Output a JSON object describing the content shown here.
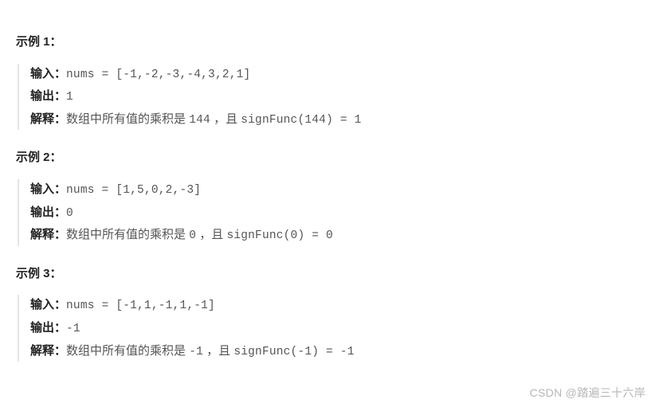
{
  "labels": {
    "input": "输入：",
    "output": "输出：",
    "explain": "解释："
  },
  "examples": [
    {
      "title": "示例 1：",
      "input": "nums = [-1,-2,-3,-4,3,2,1]",
      "output": "1",
      "explain_prefix": "数组中所有值的乘积是 ",
      "product": "144",
      "explain_mid": " ，且 ",
      "sign_expr": "signFunc(144) = 1"
    },
    {
      "title": "示例 2：",
      "input": "nums = [1,5,0,2,-3]",
      "output": "0",
      "explain_prefix": "数组中所有值的乘积是 ",
      "product": "0",
      "explain_mid": " ，且 ",
      "sign_expr": "signFunc(0) = 0"
    },
    {
      "title": "示例 3：",
      "input": "nums = [-1,1,-1,1,-1]",
      "output": "-1",
      "explain_prefix": "数组中所有值的乘积是 ",
      "product": "-1",
      "explain_mid": " ，且 ",
      "sign_expr": "signFunc(-1) = -1"
    }
  ],
  "watermark": "CSDN @踏遍三十六岸"
}
